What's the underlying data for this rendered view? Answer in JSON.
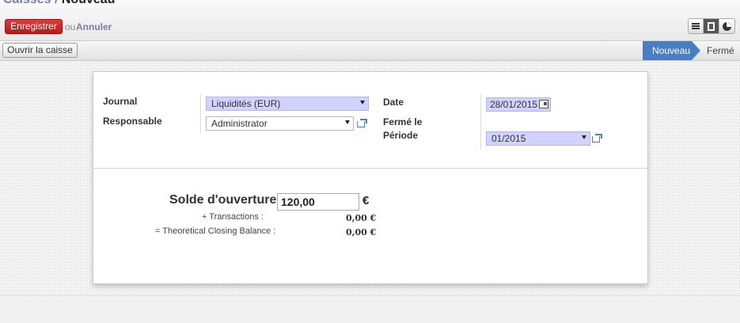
{
  "breadcrumb": {
    "parent": "Caisses",
    "separator": "/",
    "current": "Nouveau"
  },
  "toolbar": {
    "save_label": "Enregistrer",
    "or_text": "ou",
    "cancel_label": "Annuler"
  },
  "view_switch": {
    "views": [
      "list-icon",
      "form-icon",
      "graph-icon"
    ],
    "active": "form"
  },
  "statusbar": {
    "open_button_label": "Ouvrir la caisse",
    "stages": [
      {
        "label": "Nouveau",
        "active": true
      },
      {
        "label": "Fermé",
        "active": false
      }
    ]
  },
  "form": {
    "journal_label": "Journal",
    "journal_value": "Liquidités (EUR)",
    "responsible_label": "Responsable",
    "responsible_value": "Administrator",
    "date_label": "Date",
    "date_value": "28/01/2015",
    "closed_label": "Fermé le",
    "period_label": "Période",
    "period_value": "01/2015"
  },
  "balance": {
    "opening_label": "Solde d'ouverture :",
    "opening_value": "120,00",
    "currency": "€",
    "transactions_label": "+ Transactions :",
    "transactions_value": "0,00 €",
    "closing_label": "= Theoretical Closing Balance :",
    "closing_value": "0,00 €"
  },
  "colors": {
    "save_button": "#c62828",
    "link": "#7c7bad",
    "stage_active": "#4a7ec1",
    "required_field": "#d2d2ff"
  }
}
